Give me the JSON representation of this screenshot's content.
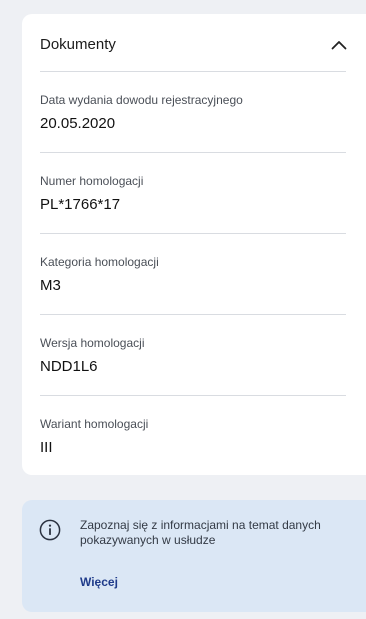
{
  "documents": {
    "title": "Dokumenty",
    "collapse_icon": "chevron-up-icon",
    "fields": [
      {
        "label": "Data wydania dowodu rejestracyjnego",
        "value": "20.05.2020"
      },
      {
        "label": "Numer homologacji",
        "value": "PL*1766*17"
      },
      {
        "label": "Kategoria homologacji",
        "value": "M3"
      },
      {
        "label": "Wersja homologacji",
        "value": "NDD1L6"
      },
      {
        "label": "Wariant homologacji",
        "value": "III"
      }
    ]
  },
  "info": {
    "icon": "info-icon",
    "text": "Zapoznaj się z informacjami na temat danych pokazywanych w usłudze",
    "link_label": "Więcej"
  },
  "colors": {
    "background": "#eef0f4",
    "card": "#ffffff",
    "info_background": "#dbe7f5",
    "link": "#1f3b8a"
  }
}
